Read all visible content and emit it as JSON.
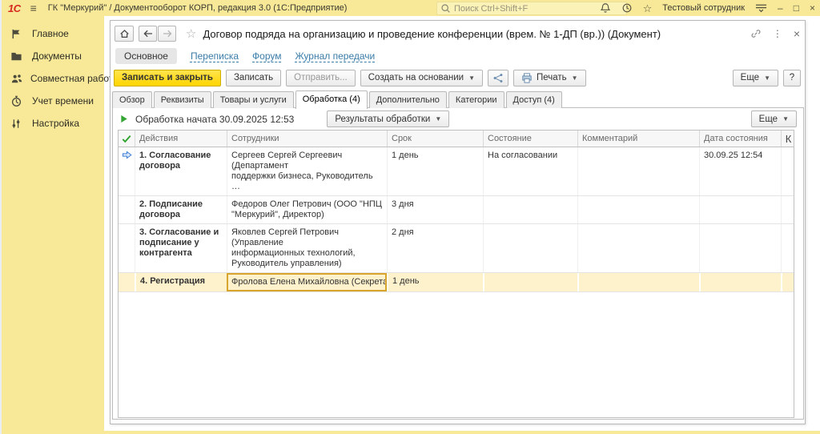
{
  "colors": {
    "yellow": "#f8e999",
    "btnyellow": "#ffd500",
    "link": "#3a7ca8",
    "green": "#2da32d",
    "blue": "#3f7fd6",
    "selborder": "#d9a42c",
    "selrow": "#fdf2cc"
  },
  "topbar": {
    "logo": "1С",
    "app_title": "ГК \"Меркурий\" / Документооборот КОРП, редакция 3.0  (1С:Предприятие)",
    "search_placeholder": "Поиск Ctrl+Shift+F",
    "user": "Тестовый сотрудник"
  },
  "sidebar": {
    "items": [
      {
        "key": "main",
        "icon": "flag-icon",
        "label": "Главное"
      },
      {
        "key": "documents",
        "icon": "documents-icon",
        "label": "Документы"
      },
      {
        "key": "teamwork",
        "icon": "teamwork-icon",
        "label": "Совместная работа"
      },
      {
        "key": "time",
        "icon": "time-icon",
        "label": "Учет времени"
      },
      {
        "key": "settings",
        "icon": "settings-icon",
        "label": "Настройка"
      }
    ]
  },
  "window": {
    "title": "Договор подряда на организацию и проведение конференции (врем. № 1-ДП (вр.)) (Документ)",
    "nav": {
      "active": "Основное",
      "links": [
        "Переписка",
        "Форум",
        "Журнал передачи"
      ]
    },
    "toolbar": {
      "save_close": "Записать и закрыть",
      "save": "Записать",
      "send": "Отправить...",
      "create_from": "Создать на основании",
      "print": "Печать",
      "more": "Еще",
      "help": "?"
    },
    "tabs": [
      {
        "label": "Обзор",
        "active": false
      },
      {
        "label": "Реквизиты",
        "active": false
      },
      {
        "label": "Товары и услуги",
        "active": false
      },
      {
        "label": "Обработка (4)",
        "active": true
      },
      {
        "label": "Дополнительно",
        "active": false
      },
      {
        "label": "Категории",
        "active": false
      },
      {
        "label": "Доступ (4)",
        "active": false
      }
    ],
    "processing": {
      "status": "Обработка начата 30.09.2025 12:53",
      "results": "Результаты обработки",
      "more": "Еще"
    },
    "table": {
      "columns": [
        "Действия",
        "Сотрудники",
        "Срок",
        "Состояние",
        "Комментарий",
        "Дата состояния",
        "К"
      ],
      "rows": [
        {
          "action": "1. Согласование\nдоговора",
          "employee": "Сергеев Сергей Сергеевич (Департамент\nподдержки бизнеса, Руководитель …",
          "term": "1 день",
          "state": "На согласовании",
          "comment": "",
          "date": "30.09.25 12:54",
          "current": true,
          "selected": false
        },
        {
          "action": "2. Подписание\nдоговора",
          "employee": "Федоров Олег Петрович (ООО \"НПЦ\n\"Меркурий\", Директор)",
          "term": "3 дня",
          "state": "",
          "comment": "",
          "date": "",
          "current": false,
          "selected": false
        },
        {
          "action": "3. Согласование и\nподписание у\nконтрагента",
          "employee": "Яковлев Сергей Петрович (Управление\nинформационных технологий,\nРуководитель управления)",
          "term": "2 дня",
          "state": "",
          "comment": "",
          "date": "",
          "current": false,
          "selected": false
        },
        {
          "action": "4. Регистрация",
          "employee": "Фролова Елена Михайловна (Секретари…",
          "term": "1 день",
          "state": "",
          "comment": "",
          "date": "",
          "current": false,
          "selected": true
        }
      ]
    }
  }
}
